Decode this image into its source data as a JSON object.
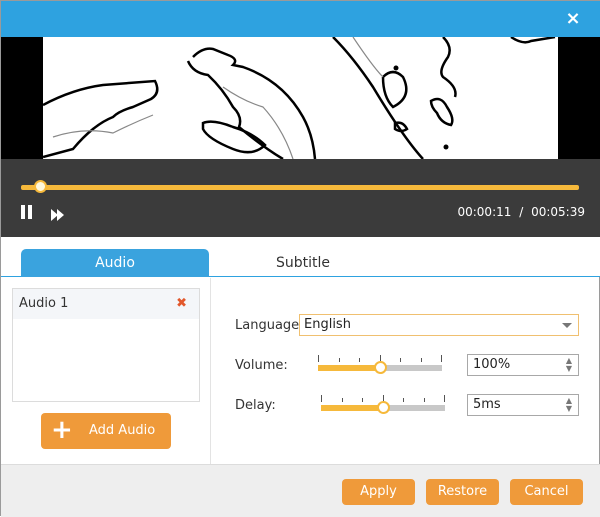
{
  "titlebar": {
    "close_icon": "×"
  },
  "player": {
    "progress": 0.034,
    "current_time": "00:00:11",
    "separator": "/",
    "total_time": "00:05:39",
    "pause_icon": "pause-icon",
    "fast_forward_icon": "fast-forward-icon"
  },
  "tabs": [
    {
      "label": "Audio",
      "active": true
    },
    {
      "label": "Subtitle",
      "active": false
    }
  ],
  "audio_list": {
    "items": [
      {
        "label": "Audio 1",
        "delete_icon": "✖"
      }
    ],
    "add_button": {
      "icon": "+",
      "label": "Add Audio"
    }
  },
  "settings": {
    "language": {
      "label": "Language:",
      "value": "English"
    },
    "volume": {
      "label": "Volume:",
      "slider_fraction": 0.5,
      "value": "100%"
    },
    "delay": {
      "label": "Delay:",
      "slider_fraction": 0.5,
      "value": "5ms"
    }
  },
  "footer": {
    "apply": "Apply",
    "restore": "Restore",
    "cancel": "Cancel"
  },
  "colors": {
    "titlebar": "#2ea2e0",
    "accent_orange": "#ef9a3a",
    "progress": "#f6b93b",
    "tab_active": "#3aa3de",
    "delete": "#e2582c"
  }
}
